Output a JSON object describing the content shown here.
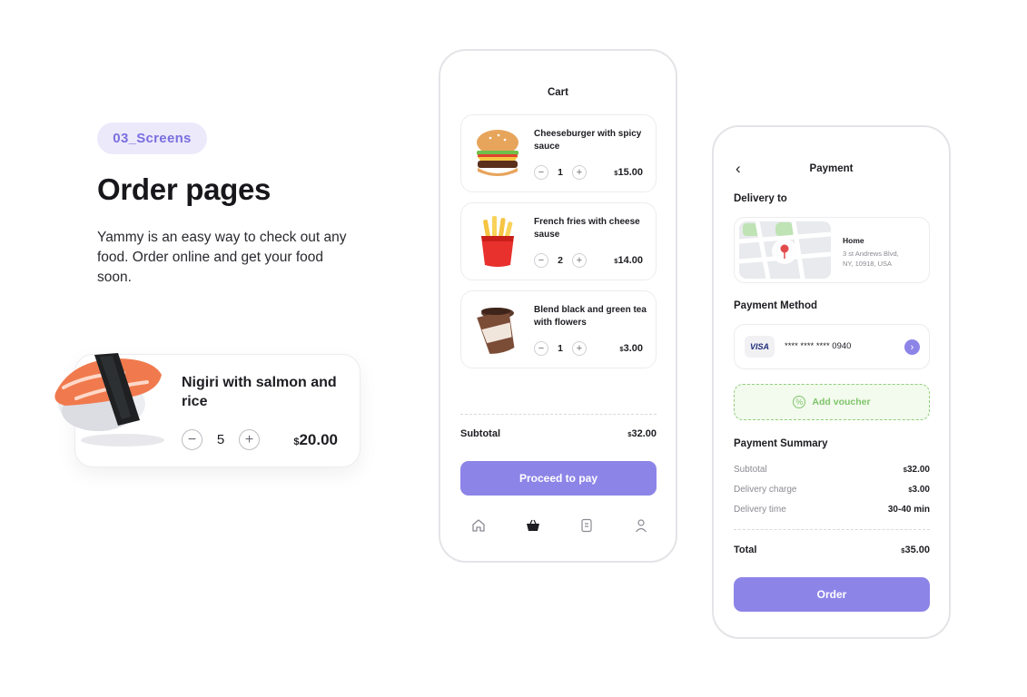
{
  "intro": {
    "tag": "03_Screens",
    "title": "Order pages",
    "description": "Yammy is an easy way to check out any food. Order online and get your food soon."
  },
  "featured_item": {
    "name": "Nigiri with salmon and rice",
    "quantity": "5",
    "currency": "$",
    "price": "20.00",
    "minus": "−",
    "plus": "+"
  },
  "cart": {
    "title": "Cart",
    "items": [
      {
        "name": "Cheeseburger with spicy sauce",
        "quantity": "1",
        "currency": "$",
        "price": "15.00",
        "icon": "burger-icon"
      },
      {
        "name": "French fries with cheese sause",
        "quantity": "2",
        "currency": "$",
        "price": "14.00",
        "icon": "fries-icon"
      },
      {
        "name": "Blend black and green tea with flowers",
        "quantity": "1",
        "currency": "$",
        "price": "3.00",
        "icon": "coffee-cup-icon"
      }
    ],
    "subtotal_label": "Subtotal",
    "subtotal_currency": "$",
    "subtotal_value": "32.00",
    "proceed_label": "Proceed to pay",
    "nav": [
      "home-icon",
      "basket-icon",
      "orders-icon",
      "profile-icon"
    ]
  },
  "payment": {
    "back": "‹",
    "title": "Payment",
    "delivery_label": "Delivery to",
    "address_name": "Home",
    "address_line1": "3 st Andrews Blvd,",
    "address_line2": "NY, 10918, USA",
    "method_label": "Payment Method",
    "card_brand": "VISA",
    "card_number": "**** **** **** 0940",
    "voucher_label": "Add voucher",
    "summary_label": "Payment Summary",
    "summary": [
      {
        "label": "Subtotal",
        "currency": "$",
        "value": "32.00"
      },
      {
        "label": "Delivery charge",
        "currency": "$",
        "value": "3.00"
      },
      {
        "label": "Delivery time",
        "currency": "",
        "value": "30-40 min"
      }
    ],
    "total_label": "Total",
    "total_currency": "$",
    "total_value": "35.00",
    "order_label": "Order"
  },
  "colors": {
    "accent": "#8d84e8",
    "tag_bg": "#ece9fb",
    "voucher_green": "#7fc56b"
  }
}
